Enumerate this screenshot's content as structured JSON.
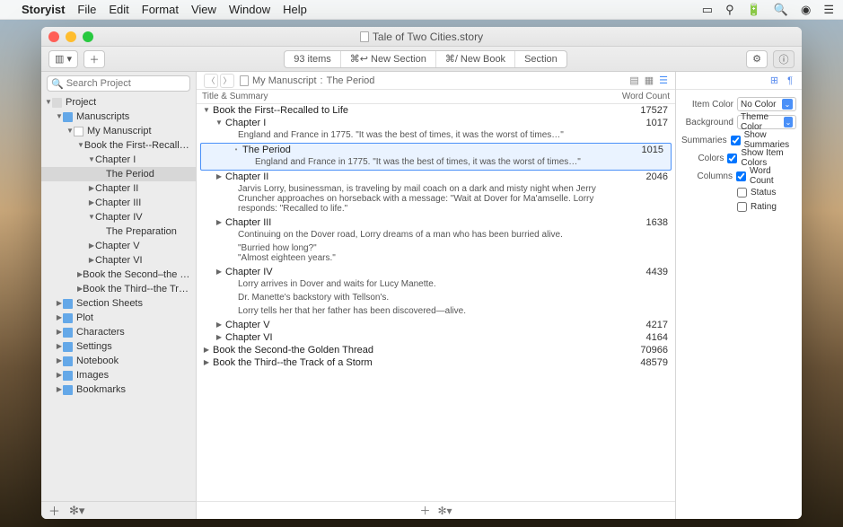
{
  "menubar": {
    "app": "Storyist",
    "items": [
      "File",
      "Edit",
      "Format",
      "View",
      "Window",
      "Help"
    ]
  },
  "window": {
    "title": "Tale of Two Cities.story"
  },
  "toolbar": {
    "items_count": "93 items",
    "new_section": "⌘↩︎ New Section",
    "new_book": "⌘/ New Book",
    "section": "Section"
  },
  "sidebar": {
    "search_placeholder": "Search Project",
    "tree": [
      {
        "d": 0,
        "a": "down",
        "i": "folder blank",
        "label": "Project"
      },
      {
        "d": 1,
        "a": "down",
        "i": "folder",
        "label": "Manuscripts"
      },
      {
        "d": 2,
        "a": "down",
        "i": "doc",
        "label": "My Manuscript"
      },
      {
        "d": 3,
        "a": "down",
        "i": "",
        "label": "Book the First--Recalled to Life"
      },
      {
        "d": 4,
        "a": "down",
        "i": "",
        "label": "Chapter I"
      },
      {
        "d": 5,
        "a": "",
        "i": "",
        "label": "The Period",
        "sel": true
      },
      {
        "d": 4,
        "a": "right",
        "i": "",
        "label": "Chapter II"
      },
      {
        "d": 4,
        "a": "right",
        "i": "",
        "label": "Chapter III"
      },
      {
        "d": 4,
        "a": "down",
        "i": "",
        "label": "Chapter IV"
      },
      {
        "d": 5,
        "a": "",
        "i": "",
        "label": "The Preparation"
      },
      {
        "d": 4,
        "a": "right",
        "i": "",
        "label": "Chapter V"
      },
      {
        "d": 4,
        "a": "right",
        "i": "",
        "label": "Chapter VI"
      },
      {
        "d": 3,
        "a": "right",
        "i": "",
        "label": "Book the Second–the Golden Thread"
      },
      {
        "d": 3,
        "a": "right",
        "i": "",
        "label": "Book the Third--the Track of a Storm"
      },
      {
        "d": 1,
        "a": "right",
        "i": "folder",
        "label": "Section Sheets"
      },
      {
        "d": 1,
        "a": "right",
        "i": "folder",
        "label": "Plot"
      },
      {
        "d": 1,
        "a": "right",
        "i": "folder",
        "label": "Characters"
      },
      {
        "d": 1,
        "a": "right",
        "i": "folder",
        "label": "Settings"
      },
      {
        "d": 1,
        "a": "right",
        "i": "folder",
        "label": "Notebook"
      },
      {
        "d": 1,
        "a": "right",
        "i": "folder",
        "label": "Images"
      },
      {
        "d": 1,
        "a": "right",
        "i": "folder",
        "label": "Bookmarks"
      }
    ]
  },
  "pathbar": {
    "b1": "My Manuscript",
    "b2": "The Period"
  },
  "columns": {
    "c1": "Title & Summary",
    "c2": "Word Count"
  },
  "outline": [
    {
      "ind": 0,
      "a": "down",
      "title": "Book the First--Recalled to Life",
      "wc": "17527"
    },
    {
      "ind": 1,
      "a": "down",
      "title": "Chapter I",
      "wc": "1017"
    },
    {
      "ind": 2,
      "sum": "England and France in 1775. \"It was the best of times, it was the worst of times…\""
    },
    {
      "ind": 2,
      "a": "",
      "title": "The Period",
      "wc": "1015",
      "sel": true
    },
    {
      "ind": 3,
      "sum": "England and France in 1775. \"It was the best of times, it was the worst of times…\"",
      "sel": true
    },
    {
      "ind": 1,
      "a": "right",
      "title": "Chapter II",
      "wc": "2046"
    },
    {
      "ind": 2,
      "sum": "Jarvis Lorry, businessman, is traveling by mail coach on a dark and misty night when Jerry Cruncher approaches on horseback with a message: \"Wait at Dover for Ma'amselle. Lorry responds: \"Recalled to life.\""
    },
    {
      "ind": 1,
      "a": "right",
      "title": "Chapter III",
      "wc": "1638"
    },
    {
      "ind": 2,
      "sum": "Continuing on the Dover road, Lorry dreams of a man who has been burried alive."
    },
    {
      "ind": 2,
      "sum": "\"Burried how long?\"\n\"Almost eighteen years.\""
    },
    {
      "ind": 1,
      "a": "right",
      "title": "Chapter IV",
      "wc": "4439"
    },
    {
      "ind": 2,
      "sum": "Lorry arrives in Dover and waits for Lucy Manette."
    },
    {
      "ind": 2,
      "sum": "Dr. Manette's backstory with Tellson's."
    },
    {
      "ind": 2,
      "sum": "Lorry tells her that her father has been discovered—alive."
    },
    {
      "ind": 1,
      "a": "right",
      "title": "Chapter V",
      "wc": "4217"
    },
    {
      "ind": 1,
      "a": "right",
      "title": "Chapter VI",
      "wc": "4164"
    },
    {
      "ind": 0,
      "a": "right",
      "title": "Book the Second-the Golden Thread",
      "wc": "70966"
    },
    {
      "ind": 0,
      "a": "right",
      "title": "Book the Third--the Track of a Storm",
      "wc": "48579"
    }
  ],
  "inspector": {
    "item_color_label": "Item Color",
    "item_color": "No Color",
    "background_label": "Background",
    "background": "Theme Color",
    "summaries_label": "Summaries",
    "summaries_chk": "Show Summaries",
    "colors_label": "Colors",
    "colors_chk": "Show Item Colors",
    "columns_label": "Columns",
    "col_wc": "Word Count",
    "col_status": "Status",
    "col_rating": "Rating"
  }
}
